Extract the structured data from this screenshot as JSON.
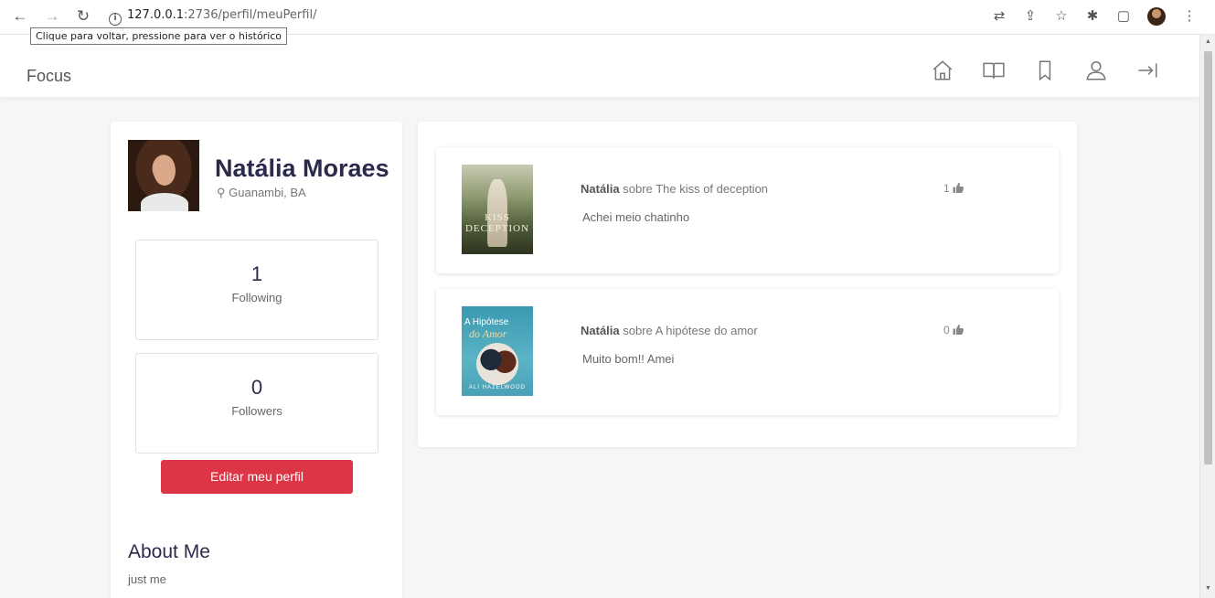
{
  "browser": {
    "url_host": "127.0.0.1",
    "url_port_path": ":2736/perfil/meuPerfil/",
    "tooltip": "Clique para voltar, pressione para ver o histórico"
  },
  "header": {
    "brand": "Focus"
  },
  "profile": {
    "name": "Natália Moraes",
    "location": "Guanambi, BA",
    "following_count": "1",
    "following_label": "Following",
    "followers_count": "0",
    "followers_label": "Followers",
    "edit_label": "Editar meu perfil",
    "about_title": "About Me",
    "about_text": "just me"
  },
  "reviews": [
    {
      "author": "Natália",
      "connector": "sobre",
      "book": "The kiss of deception",
      "text": "Achei meio chatinho",
      "likes": "1",
      "cover_text": "KISS DECEPTION"
    },
    {
      "author": "Natália",
      "connector": "sobre",
      "book": "A hipótese do amor",
      "text": "Muito bom!! Amei",
      "likes": "0",
      "cover_title": "A Hipótese",
      "cover_sub": "do Amor",
      "cover_author": "ALI HAZELWOOD"
    }
  ],
  "colors": {
    "accent": "#dc3545",
    "title": "#2b2a4c"
  }
}
